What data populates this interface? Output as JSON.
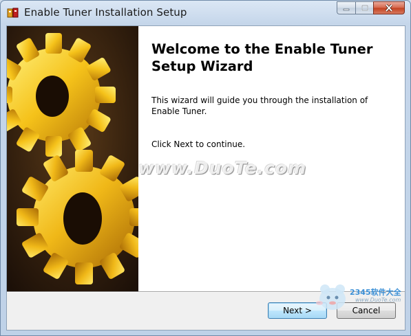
{
  "window": {
    "title": "Enable Tuner Installation Setup",
    "app_icon": "setup-icon",
    "caption_buttons": [
      "minimize-icon",
      "maximize-icon",
      "close-icon"
    ]
  },
  "wizard": {
    "heading": "Welcome to the Enable Tuner Setup Wizard",
    "body": "This wizard will guide you through the installation of Enable Tuner.",
    "continue_hint": "Click Next to continue.",
    "banner_image": "gears-image"
  },
  "buttons": {
    "next_label": "Next >",
    "cancel_label": "Cancel"
  },
  "watermarks": {
    "center": "www.DuoTe.com",
    "corner_brand": "2345软件大全",
    "corner_url": "www.DuoTe.com"
  },
  "colors": {
    "titlebar": "#c5d6ea",
    "close_button": "#c2401f",
    "default_button_border": "#3c7fb1",
    "content_bg": "#ffffff",
    "gear_yellow": "#f5c21a"
  }
}
